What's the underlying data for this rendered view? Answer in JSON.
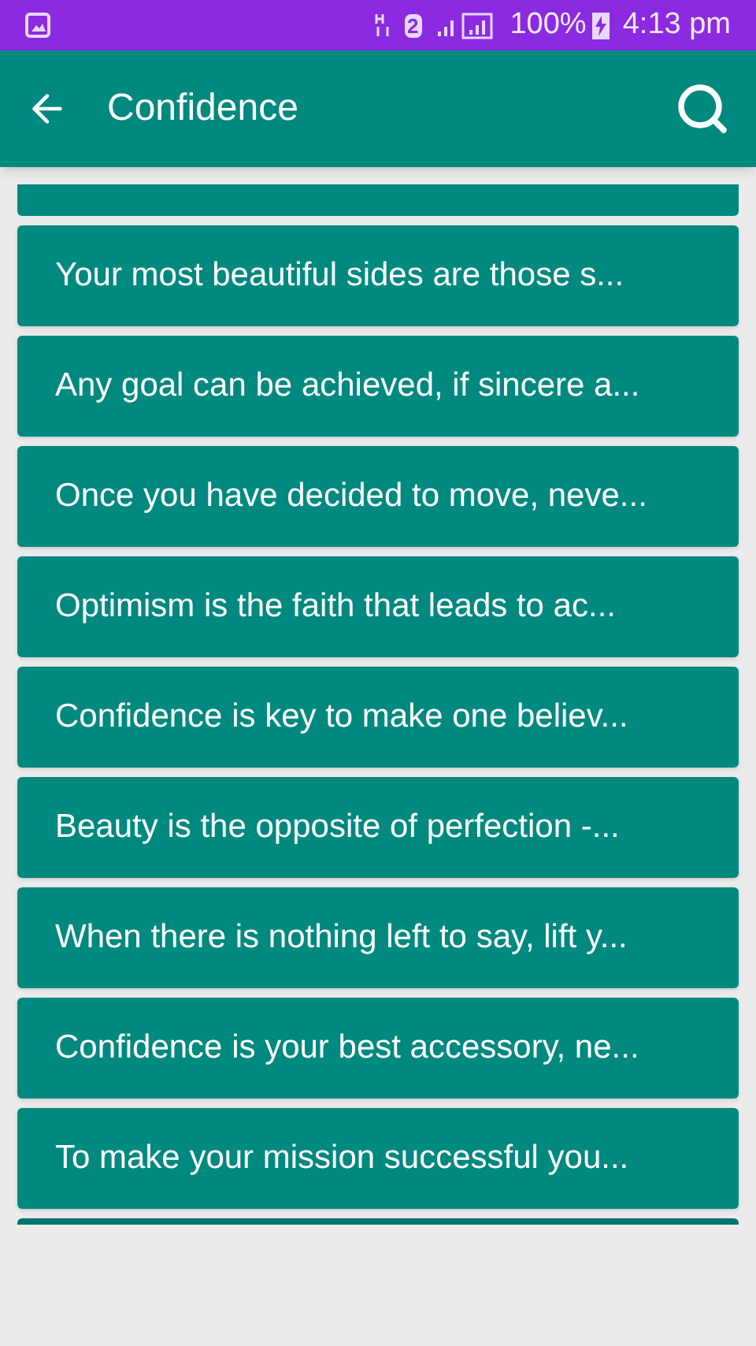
{
  "status_bar": {
    "sim": "2",
    "battery": "100%",
    "time": "4:13 pm"
  },
  "app_bar": {
    "title": "Confidence"
  },
  "quotes": [
    {
      "text": "Your most beautiful sides are those s..."
    },
    {
      "text": "Any goal can be achieved, if sincere a..."
    },
    {
      "text": "Once you have decided to move, neve..."
    },
    {
      "text": "Optimism is the faith that leads to ac..."
    },
    {
      "text": "Confidence is key to make one believ..."
    },
    {
      "text": "Beauty is the opposite of perfection -..."
    },
    {
      "text": "When there is nothing left to say, lift y..."
    },
    {
      "text": "Confidence is your best accessory, ne..."
    },
    {
      "text": "To make your mission successful you..."
    }
  ]
}
